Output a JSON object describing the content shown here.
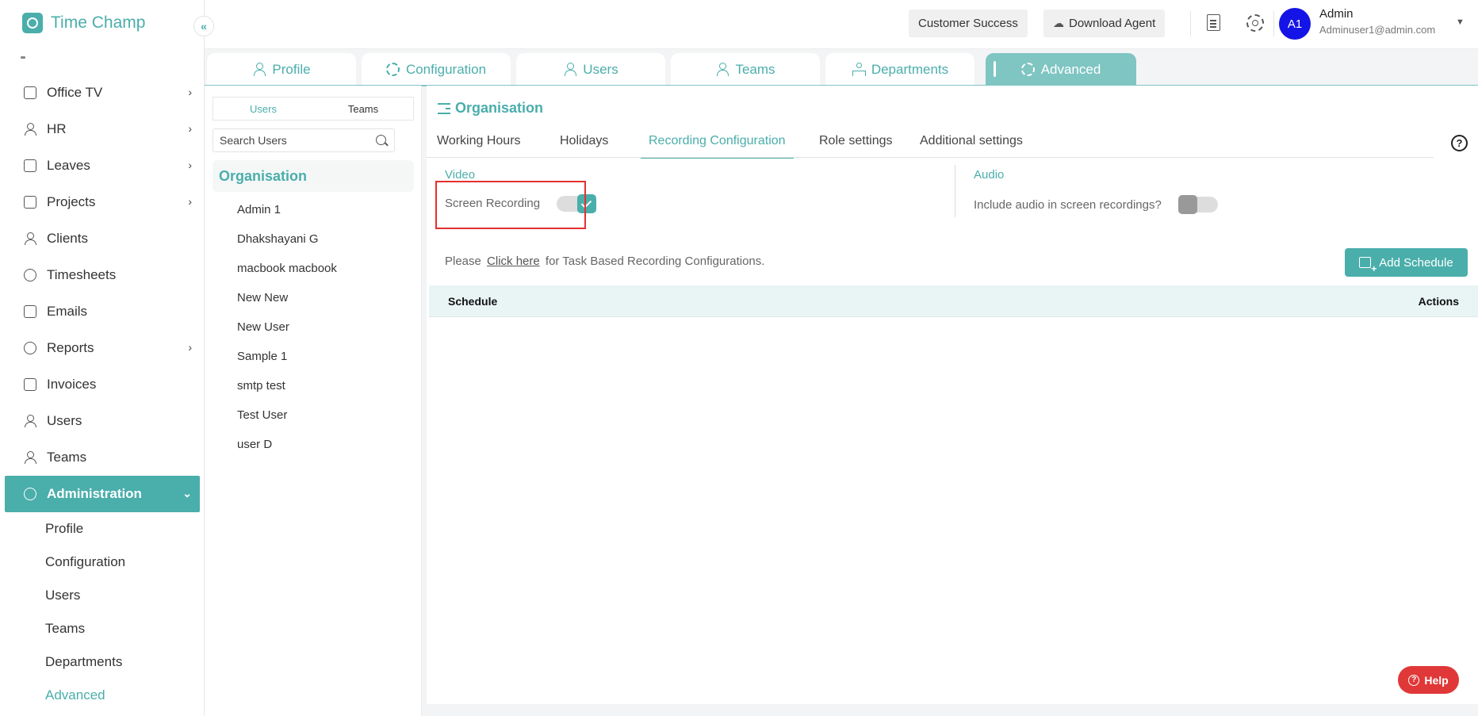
{
  "app": {
    "title": "Time Champ"
  },
  "sidebar": {
    "items": [
      {
        "label": "Office TV",
        "has_children": true,
        "icon": "tv-icon"
      },
      {
        "label": "HR",
        "has_children": true,
        "icon": "person-icon"
      },
      {
        "label": "Leaves",
        "has_children": true,
        "icon": "calendar-icon"
      },
      {
        "label": "Projects",
        "has_children": true,
        "icon": "briefcase-icon"
      },
      {
        "label": "Clients",
        "has_children": false,
        "icon": "person-icon"
      },
      {
        "label": "Timesheets",
        "has_children": false,
        "icon": "clock-icon"
      },
      {
        "label": "Emails",
        "has_children": false,
        "icon": "mail-icon"
      },
      {
        "label": "Reports",
        "has_children": true,
        "icon": "pie-chart-icon"
      },
      {
        "label": "Invoices",
        "has_children": false,
        "icon": "invoice-icon"
      },
      {
        "label": "Users",
        "has_children": false,
        "icon": "users-icon"
      },
      {
        "label": "Teams",
        "has_children": false,
        "icon": "teams-icon"
      }
    ],
    "active": {
      "label": "Administration",
      "icon": "gear-icon"
    },
    "sub_items": [
      {
        "label": "Profile"
      },
      {
        "label": "Configuration"
      },
      {
        "label": "Users"
      },
      {
        "label": "Teams"
      },
      {
        "label": "Departments"
      },
      {
        "label": "Advanced"
      }
    ]
  },
  "header": {
    "customer_success": "Customer Success",
    "download_agent": "Download Agent",
    "user": {
      "initials": "A1",
      "name": "Admin",
      "email": "Adminuser1@admin.com"
    }
  },
  "top_tabs": [
    {
      "label": "Profile",
      "icon": "person-icon"
    },
    {
      "label": "Configuration",
      "icon": "gears-icon"
    },
    {
      "label": "Users",
      "icon": "users-icon"
    },
    {
      "label": "Teams",
      "icon": "teams-icon"
    },
    {
      "label": "Departments",
      "icon": "hierarchy-icon"
    },
    {
      "label": "Advanced",
      "icon": "gear-icon",
      "active": true
    }
  ],
  "user_panel": {
    "tabs": [
      "Users",
      "Teams"
    ],
    "search_placeholder": "Search Users",
    "org_label": "Organisation",
    "users": [
      "Admin 1",
      "Dhakshayani G",
      "macbook macbook",
      "New New",
      "New User",
      "Sample 1",
      "smtp test",
      "Test User",
      "user D"
    ]
  },
  "main": {
    "title": "Organisation",
    "tabs": [
      "Working Hours",
      "Holidays",
      "Recording Configuration",
      "Role settings",
      "Additional settings"
    ],
    "active_tab": "Recording Configuration",
    "video": {
      "section": "Video",
      "label": "Screen Recording",
      "enabled": true
    },
    "audio": {
      "section": "Audio",
      "label": "Include audio in screen recordings?",
      "enabled": false
    },
    "hint": {
      "before": "Please",
      "link": "Click here",
      "after": "for Task Based Recording Configurations."
    },
    "add_schedule": "Add Schedule",
    "table": {
      "columns": [
        "Schedule",
        "Actions"
      ],
      "rows": []
    }
  },
  "help_button": "Help",
  "colors": {
    "accent": "#4aaeab",
    "accent_light": "#7fc5c2",
    "avatar": "#1414e6",
    "highlight": "#e53030",
    "help": "#e03838"
  }
}
